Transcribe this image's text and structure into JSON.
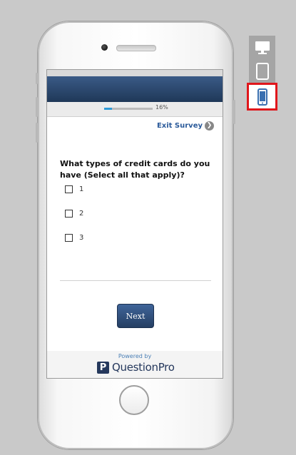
{
  "progress": {
    "percent_label": "16%",
    "fraction": 0.16
  },
  "survey": {
    "exit_label": "Exit Survey",
    "question": "What types of credit cards do you have (Select all that apply)?",
    "options": [
      {
        "label": "1",
        "checked": false
      },
      {
        "label": "2",
        "checked": false
      },
      {
        "label": "3",
        "checked": false
      }
    ],
    "next_label": "Next"
  },
  "footer": {
    "powered_by": "Powered by",
    "brand": "QuestionPro",
    "logo_letter": "P"
  },
  "device_selector": {
    "items": [
      {
        "name": "desktop",
        "icon": "desktop-icon",
        "active": false
      },
      {
        "name": "tablet",
        "icon": "tablet-icon",
        "active": false
      },
      {
        "name": "phone",
        "icon": "phone-icon",
        "active": true
      }
    ],
    "active_color": "#e0161b"
  }
}
